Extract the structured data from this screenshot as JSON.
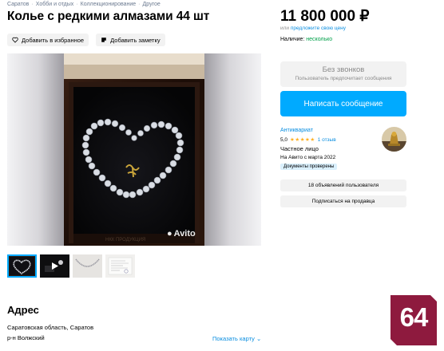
{
  "breadcrumbs": [
    "Саратов",
    "Хобби и отдых",
    "Коллекционирование",
    "Другое"
  ],
  "listing": {
    "title": "Колье с редкими алмазами 44 шт"
  },
  "actions": {
    "favorite_label": "Добавить в избранное",
    "note_label": "Добавить заметку"
  },
  "gallery": {
    "watermark": "Avito",
    "thumbnail_count": 4,
    "active_thumbnail": 1,
    "video_thumbnail": 2
  },
  "price": {
    "value": "11 800 000 ₽",
    "hint_prefix": "или",
    "hint_link": "предложите свою цену",
    "availability_label": "Наличие:",
    "availability_value": "несколько"
  },
  "contact": {
    "no_calls_title": "Без звонков",
    "no_calls_subtitle": "Пользователь предпочитает сообщения",
    "write_button": "Написать сообщение"
  },
  "seller": {
    "name": "Антиквариат",
    "rating": "5,0",
    "stars": "★★★★★",
    "reviews": "1 отзыв",
    "type": "Частное лицо",
    "since": "На Авито с марта 2022",
    "docs_badge": "Документы проверены",
    "ads_button": "18 объявлений пользователя",
    "subscribe_button": "Подписаться на продавца"
  },
  "address": {
    "heading": "Адрес",
    "line1": "Саратовская область, Саратов",
    "line2": "р-н Волжский",
    "map_link": "Показать карту ⌄"
  },
  "region_badge": "64",
  "colors": {
    "accent": "#00aaff",
    "link": "#0a8ee0",
    "available": "#02a04a",
    "badge": "#8e1a3e",
    "stars": "#ffb021"
  }
}
